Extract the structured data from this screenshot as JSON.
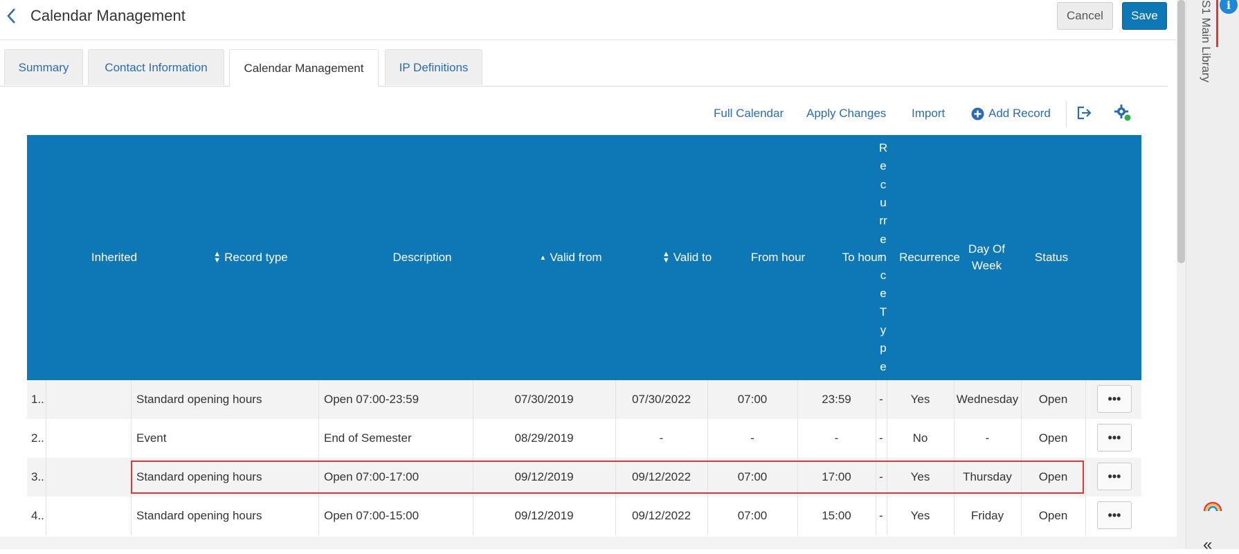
{
  "header": {
    "title": "Calendar Management",
    "cancel_label": "Cancel",
    "save_label": "Save"
  },
  "tabs": [
    {
      "label": "Summary"
    },
    {
      "label": "Contact Information"
    },
    {
      "label": "Calendar Management",
      "active": true
    },
    {
      "label": "IP Definitions"
    }
  ],
  "toolbar": {
    "full_calendar": "Full Calendar",
    "apply_changes": "Apply Changes",
    "import": "Import",
    "add_record": "Add Record",
    "icons": [
      "plus-circle-icon",
      "export-icon",
      "settings-gear-icon"
    ]
  },
  "table": {
    "columns": {
      "inherited": "Inherited",
      "record_type": "Record type",
      "description": "Description",
      "valid_from": "Valid from",
      "valid_to": "Valid to",
      "from_hour": "From hour",
      "to_hour": "To hour",
      "recurrence_type": [
        "R",
        "e",
        "c",
        "u",
        "rr",
        "e",
        "n",
        "c",
        "e",
        "T",
        "y",
        "p",
        "e"
      ],
      "recurrence": "Recurrence",
      "day_of_week": "Day Of Week",
      "status": "Status"
    },
    "rows": [
      {
        "num": "1..",
        "inherited": "",
        "record_type": "Standard opening hours",
        "description": "Open 07:00-23:59",
        "valid_from": "07/30/2019",
        "valid_to": "07/30/2022",
        "from_hour": "07:00",
        "to_hour": "23:59",
        "recurrence_type": "-",
        "recurrence": "Yes",
        "day_of_week": "Wednesday",
        "status": "Open",
        "more": "•••"
      },
      {
        "num": "2..",
        "inherited": "",
        "record_type": "Event",
        "description": "End of Semester",
        "valid_from": "08/29/2019",
        "valid_to": "-",
        "from_hour": "-",
        "to_hour": "-",
        "recurrence_type": "-",
        "recurrence": "No",
        "day_of_week": "-",
        "status": "Open",
        "more": "•••"
      },
      {
        "num": "3..",
        "inherited": "",
        "record_type": "Standard opening hours",
        "description": "Open 07:00-17:00",
        "valid_from": "09/12/2019",
        "valid_to": "09/12/2022",
        "from_hour": "07:00",
        "to_hour": "17:00",
        "recurrence_type": "-",
        "recurrence": "Yes",
        "day_of_week": "Thursday",
        "status": "Open",
        "more": "•••",
        "highlighted": true
      },
      {
        "num": "4..",
        "inherited": "",
        "record_type": "Standard opening hours",
        "description": "Open 07:00-15:00",
        "valid_from": "09/12/2019",
        "valid_to": "09/12/2022",
        "from_hour": "07:00",
        "to_hour": "15:00",
        "recurrence_type": "-",
        "recurrence": "Yes",
        "day_of_week": "Friday",
        "status": "Open",
        "more": "•••"
      }
    ]
  },
  "side_panel": {
    "text": "S1 Main Library",
    "info_icon_glyph": "i",
    "collapse_glyph": "«"
  },
  "colors": {
    "accent": "#0e78b7",
    "link": "#2b6cb0",
    "highlight_border": "#d93a3a"
  }
}
